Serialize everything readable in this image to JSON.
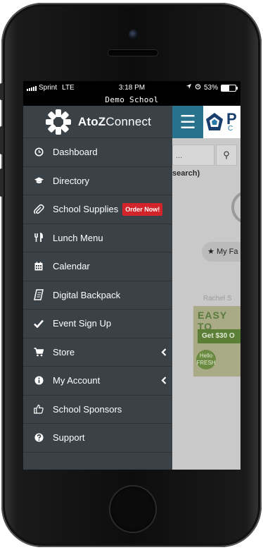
{
  "status_bar": {
    "carrier": "Sprint",
    "network": "LTE",
    "time": "3:18 PM",
    "battery": "53%",
    "battery_level": 0.53
  },
  "window_title": "Demo School",
  "brand": {
    "name_bold": "AtoZ",
    "name_light": "Connect"
  },
  "menu": [
    {
      "label": "Dashboard",
      "icon": "clock-icon"
    },
    {
      "label": "Directory",
      "icon": "graduation-cap-icon"
    },
    {
      "label": "School Supplies",
      "icon": "paperclip-icon",
      "badge": "Order Now!"
    },
    {
      "label": "Lunch Menu",
      "icon": "utensils-icon"
    },
    {
      "label": "Calendar",
      "icon": "calendar-icon"
    },
    {
      "label": "Digital Backpack",
      "icon": "scroll-icon"
    },
    {
      "label": "Event Sign Up",
      "icon": "check-icon"
    },
    {
      "label": "Store",
      "icon": "cart-icon",
      "chevron": "chevron-left-icon"
    },
    {
      "label": "My Account",
      "icon": "info-icon",
      "chevron": "chevron-left-icon"
    },
    {
      "label": "School Sponsors",
      "icon": "thumbs-up-icon"
    },
    {
      "label": "Support",
      "icon": "question-icon"
    }
  ],
  "background": {
    "logo_text": "P",
    "logo_sub": "C",
    "search_placeholder": "...",
    "search_note": "search)",
    "favorites_label": "My Fa",
    "name_fragment": "Rachel S",
    "ad_title": "EASY TO",
    "ad_button": "Get $30 O",
    "ad_logo_line1": "Hello",
    "ad_logo_line2": "FRESH"
  },
  "colors": {
    "sidebar_bg": "#3a4147",
    "accent_blue": "#29728e",
    "badge_red": "#d3242b"
  }
}
